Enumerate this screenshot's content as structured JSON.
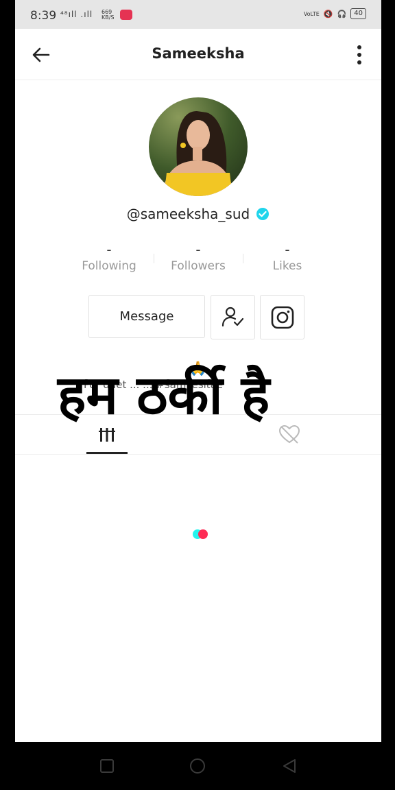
{
  "status_bar": {
    "time": "8:39",
    "signal": "⁴⁸ıll .ıll",
    "speed_value": "669",
    "speed_unit": "KB/S",
    "network": "VoLTE",
    "battery": "40"
  },
  "header": {
    "title": "Sameeksha",
    "back_icon": "arrow-left-icon",
    "more_icon": "more-vertical-icon"
  },
  "profile": {
    "handle": "@sameeksha_sud",
    "verified_color": "#20d5ec"
  },
  "stats": [
    {
      "value": "-",
      "label": "Following"
    },
    {
      "value": "-",
      "label": "Followers"
    },
    {
      "value": "-",
      "label": "Likes"
    }
  ],
  "actions": {
    "message_label": "Message",
    "follow_icon": "user-check-icon",
    "instagram_icon": "instagram-icon"
  },
  "bio": {
    "text": "For duet ...   ...   #samkesitae",
    "emoji": "🙏"
  },
  "overlay_text": "हम ठर्की है",
  "tabs": [
    {
      "icon": "grid-videos-icon",
      "active": true
    },
    {
      "icon": "liked-hidden-icon",
      "active": false
    }
  ],
  "loader": {
    "colors": [
      "#25f4ee",
      "#fe2c55"
    ]
  },
  "nav": {
    "recent_icon": "square-icon",
    "home_icon": "circle-icon",
    "back_icon": "triangle-back-icon"
  }
}
